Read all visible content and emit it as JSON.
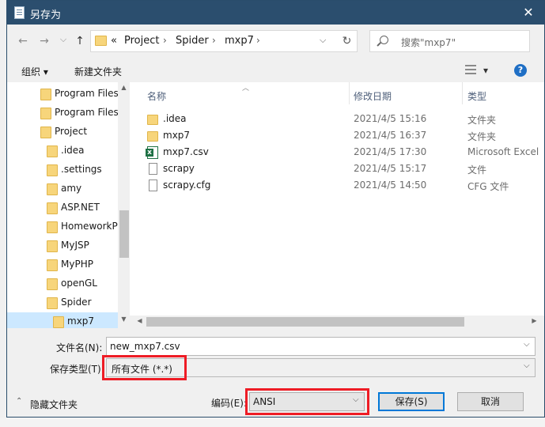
{
  "dialog": {
    "title": "另存为",
    "close": "✕"
  },
  "nav": {
    "back": "←",
    "forward": "→",
    "recent": "⌵",
    "up": "↑",
    "address": {
      "overflow": "«",
      "crumbs": [
        "Project",
        "Spider",
        "mxp7"
      ],
      "sep": "›"
    },
    "refresh": "↻",
    "search_placeholder": "搜索\"mxp7\""
  },
  "toolbar": {
    "organize": "组织 ▾",
    "new_folder": "新建文件夹",
    "view_drop": "▾",
    "help": "?"
  },
  "tree": [
    {
      "label": "Program Files",
      "indent": 0
    },
    {
      "label": "Program Files",
      "indent": 0
    },
    {
      "label": "Project",
      "indent": 0
    },
    {
      "label": ".idea",
      "indent": 1
    },
    {
      "label": ".settings",
      "indent": 1
    },
    {
      "label": "amy",
      "indent": 1
    },
    {
      "label": "ASP.NET",
      "indent": 1
    },
    {
      "label": "HomeworkP",
      "indent": 1
    },
    {
      "label": "MyJSP",
      "indent": 1
    },
    {
      "label": "MyPHP",
      "indent": 1
    },
    {
      "label": "openGL",
      "indent": 1
    },
    {
      "label": "Spider",
      "indent": 1
    },
    {
      "label": "mxp7",
      "indent": 2,
      "selected": true
    }
  ],
  "columns": {
    "name": "名称",
    "date": "修改日期",
    "type": "类型"
  },
  "files": [
    {
      "name": ".idea",
      "date": "2021/4/5 15:16",
      "type": "文件夹",
      "icon": "folder-icon"
    },
    {
      "name": "mxp7",
      "date": "2021/4/5 16:37",
      "type": "文件夹",
      "icon": "folder-icon"
    },
    {
      "name": "mxp7.csv",
      "date": "2021/4/5 17:30",
      "type": "Microsoft Excel",
      "icon": "excel-icon"
    },
    {
      "name": "scrapy",
      "date": "2021/4/5 15:17",
      "type": "文件",
      "icon": "file-icon"
    },
    {
      "name": "scrapy.cfg",
      "date": "2021/4/5 14:50",
      "type": "CFG 文件",
      "icon": "file-icon"
    }
  ],
  "form": {
    "filename_label": "文件名(N):",
    "filename_value": "new_mxp7.csv",
    "filetype_label": "保存类型(T):",
    "filetype_value": "所有文件  (*.*)",
    "encoding_label": "编码(E):",
    "encoding_value": "ANSI",
    "save": "保存(S)",
    "cancel": "取消",
    "hide_folders": "隐藏文件夹"
  },
  "colors": {
    "titlebar": "#2b4e6e",
    "highlight": "#ee1c25",
    "selection": "#cce8ff"
  }
}
